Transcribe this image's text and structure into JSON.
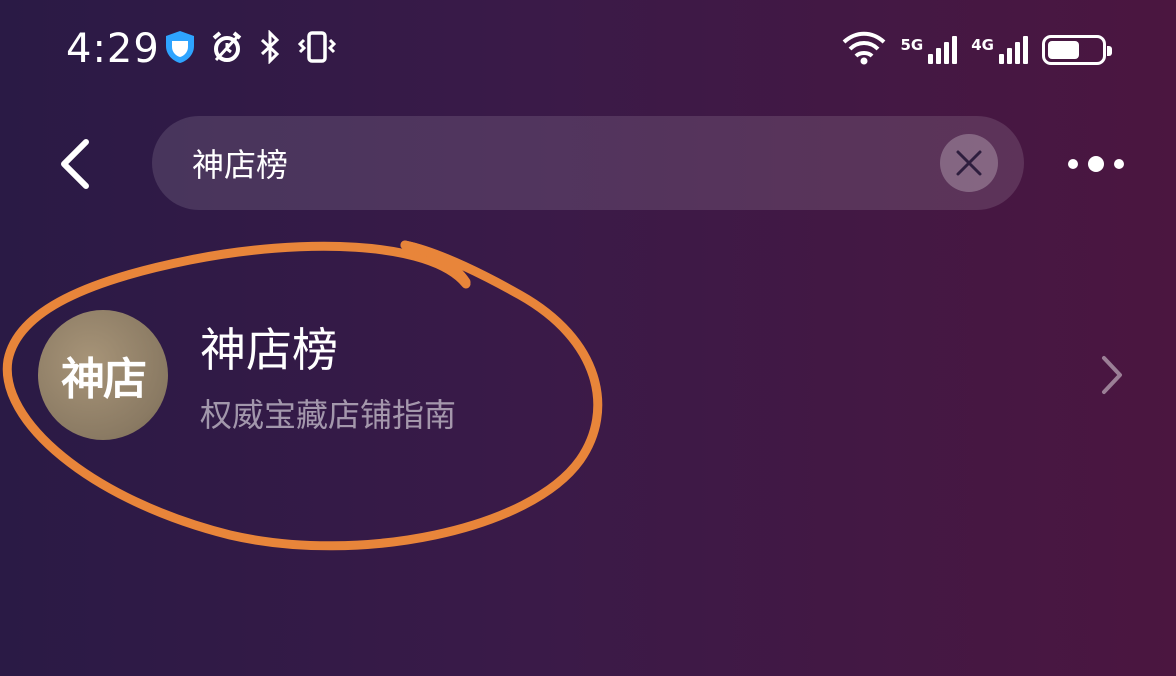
{
  "status_bar": {
    "time": "4:29",
    "left_icons": [
      "shield-icon",
      "alarm-icon",
      "bluetooth-icon",
      "vibrate-icon"
    ],
    "sim1_label": "5G",
    "sim2_label": "4G",
    "battery_level": 0.6
  },
  "search": {
    "query": "神店榜",
    "back_icon": "chevron-left-icon",
    "clear_icon": "close-icon",
    "more_icon": "more-dots-icon"
  },
  "result": {
    "avatar_text": "神店",
    "title": "神店榜",
    "subtitle": "权威宝藏店铺指南",
    "chevron_icon": "chevron-right-icon"
  },
  "colors": {
    "background_left": "#2a1a45",
    "background_right": "#4b1640",
    "annotation": "#e8853a",
    "avatar": "#8a7a63"
  }
}
